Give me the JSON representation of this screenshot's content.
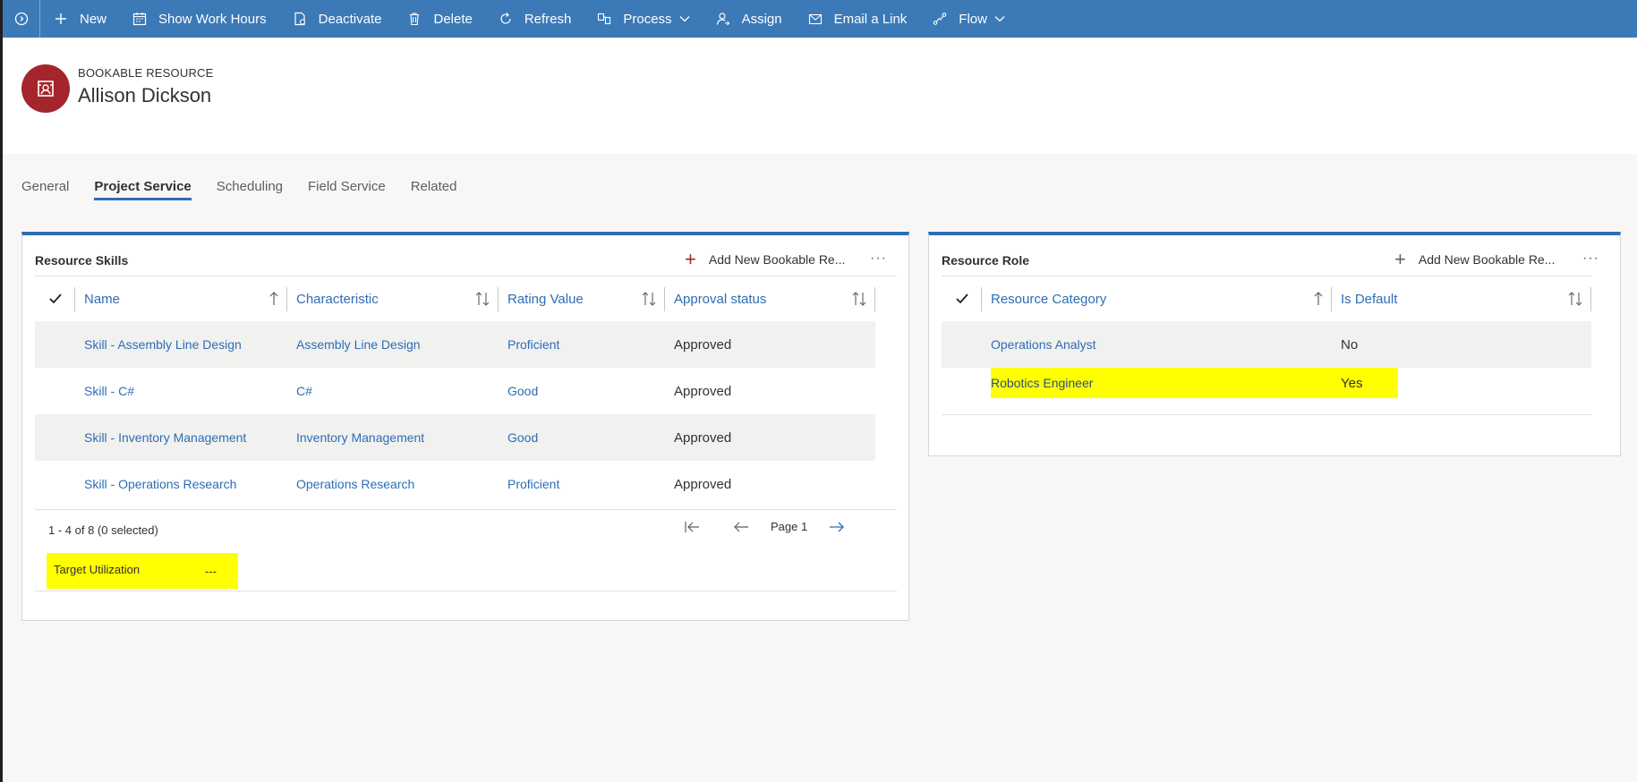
{
  "commandbar": {
    "items": [
      {
        "label": "New",
        "icon": "plus-icon"
      },
      {
        "label": "Show Work Hours",
        "icon": "calendar-icon"
      },
      {
        "label": "Deactivate",
        "icon": "document-icon"
      },
      {
        "label": "Delete",
        "icon": "trash-icon"
      },
      {
        "label": "Refresh",
        "icon": "refresh-icon"
      },
      {
        "label": "Process",
        "icon": "process-icon"
      },
      {
        "label": "Assign",
        "icon": "assign-person-icon"
      },
      {
        "label": "Email a Link",
        "icon": "email-link-icon"
      },
      {
        "label": "Flow",
        "icon": "flow-icon"
      }
    ]
  },
  "header": {
    "entity_type": "BOOKABLE RESOURCE",
    "record_name": "Allison Dickson"
  },
  "tabs": [
    {
      "label": "General"
    },
    {
      "label": "Project Service"
    },
    {
      "label": "Scheduling"
    },
    {
      "label": "Field Service"
    },
    {
      "label": "Related"
    }
  ],
  "skills": {
    "title": "Resource Skills",
    "add_label": "Add New Bookable Re...",
    "more": "···",
    "columns": [
      "Name",
      "Characteristic",
      "Rating Value",
      "Approval status"
    ],
    "rows": [
      {
        "name": "Skill - Assembly Line Design",
        "characteristic": "Assembly Line Design",
        "rating": "Proficient",
        "approval": "Approved"
      },
      {
        "name": "Skill - C#",
        "characteristic": "C#",
        "rating": "Good",
        "approval": "Approved"
      },
      {
        "name": "Skill - Inventory Management",
        "characteristic": "Inventory Management",
        "rating": "Good",
        "approval": "Approved"
      },
      {
        "name": "Skill - Operations Research",
        "characteristic": "Operations Research",
        "rating": "Proficient",
        "approval": "Approved"
      }
    ],
    "count": "1 - 4 of 8 (0 selected)",
    "page": "Page 1",
    "target_label": "Target Utilization",
    "target_value": "---"
  },
  "roles": {
    "title": "Resource Role",
    "add_label": "Add New Bookable Re...",
    "more": "···",
    "columns": [
      "Resource Category",
      "Is Default"
    ],
    "rows": [
      {
        "category": "Operations Analyst",
        "is_default": "No"
      },
      {
        "category": "Robotics Engineer",
        "is_default": "Yes"
      }
    ]
  },
  "colors": {
    "command_bar": "#3b79b7",
    "accent": "#2e6db4",
    "avatar": "#a4262c",
    "highlight": "#ffff00"
  }
}
